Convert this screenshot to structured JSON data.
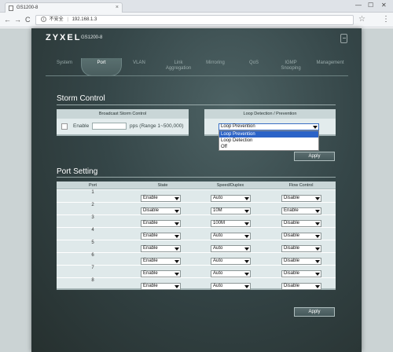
{
  "browser": {
    "tab_title": "GS1200-8",
    "tab_close": "×",
    "win_min": "—",
    "win_max": "☐",
    "win_close": "✕",
    "back": "←",
    "forward": "→",
    "reload": "C",
    "security": "不安全",
    "url": "192.168.1.3",
    "star": "☆",
    "menu": "⋮"
  },
  "app": {
    "brand": "ZYXEL",
    "model": "GS1200-8",
    "nav": [
      "System",
      "Port",
      "VLAN",
      "Link\nAggregation",
      "Mirroring",
      "QoS",
      "IGMP\nSnooping",
      "Management"
    ],
    "active_nav": "Port"
  },
  "storm_control": {
    "title": "Storm Control",
    "broadcast_header": "Broadcast Storm Control",
    "enable_label": "Enable",
    "pps_label": "pps (Range 1~500,000)",
    "rate_value": "",
    "loop_header": "Loop Detection / Prevention",
    "loop_selected": "Loop Prevention",
    "loop_options": [
      "Loop Prevention",
      "Loop Detection",
      "Off"
    ],
    "apply": "Apply"
  },
  "port_setting": {
    "title": "Port Setting",
    "columns": [
      "Port",
      "State",
      "Speed/Duplex",
      "Flow Control"
    ],
    "rows": [
      {
        "port": "1",
        "state": "Enable",
        "speed": "Auto",
        "flow": "Disable"
      },
      {
        "port": "2",
        "state": "Disable",
        "speed": "10M",
        "flow": "Enable"
      },
      {
        "port": "3",
        "state": "Enable",
        "speed": "100M",
        "flow": "Disable"
      },
      {
        "port": "4",
        "state": "Enable",
        "speed": "Auto",
        "flow": "Disable"
      },
      {
        "port": "5",
        "state": "Enable",
        "speed": "Auto",
        "flow": "Disable"
      },
      {
        "port": "6",
        "state": "Enable",
        "speed": "Auto",
        "flow": "Disable"
      },
      {
        "port": "7",
        "state": "Enable",
        "speed": "Auto",
        "flow": "Disable"
      },
      {
        "port": "8",
        "state": "Enable",
        "speed": "Auto",
        "flow": "Disable"
      }
    ],
    "apply": "Apply"
  }
}
